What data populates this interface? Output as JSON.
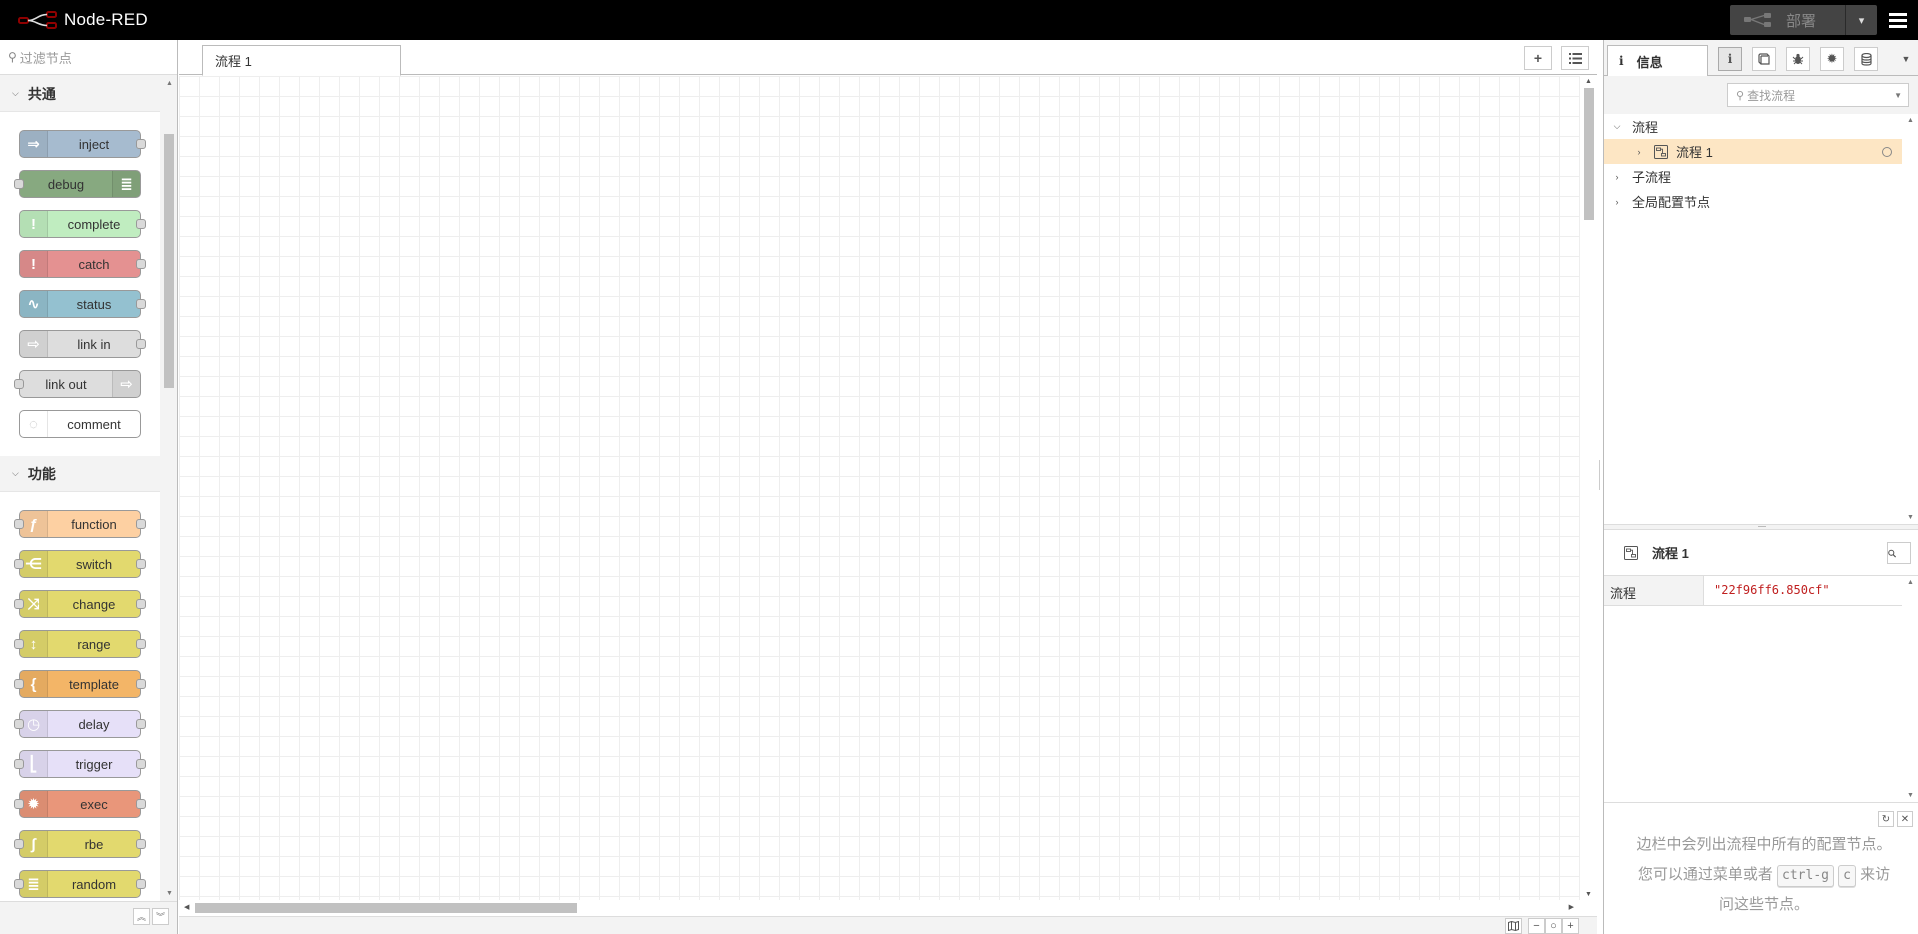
{
  "header": {
    "app_title": "Node-RED",
    "deploy_label": "部署",
    "deploy_caret": "▾",
    "menu_icon": "hamburger-icon"
  },
  "palette": {
    "search_placeholder": "过滤节点",
    "categories": [
      {
        "label": "共通",
        "nodes": [
          {
            "label": "inject",
            "color": "#a6bbcf",
            "icon_side": "left",
            "icon": "arrow-right-icon",
            "glyph": "⇒",
            "in": false,
            "out": true
          },
          {
            "label": "debug",
            "color": "#87a980",
            "icon_side": "right",
            "icon": "list-icon",
            "glyph": "≣",
            "in": true,
            "out": false
          },
          {
            "label": "complete",
            "color": "#c0edc0",
            "icon_side": "left",
            "icon": "exclamation-icon",
            "glyph": "!",
            "in": false,
            "out": true
          },
          {
            "label": "catch",
            "color": "#e49191",
            "icon_side": "left",
            "icon": "exclamation-icon",
            "glyph": "!",
            "in": false,
            "out": true
          },
          {
            "label": "status",
            "color": "#94c1d0",
            "icon_side": "left",
            "icon": "pulse-icon",
            "glyph": "∿",
            "in": false,
            "out": true
          },
          {
            "label": "link in",
            "color": "#dddddd",
            "icon_side": "left",
            "icon": "link-in-icon",
            "glyph": "⇨",
            "in": false,
            "out": true
          },
          {
            "label": "link out",
            "color": "#dddddd",
            "icon_side": "right",
            "icon": "link-out-icon",
            "glyph": "⇨",
            "in": true,
            "out": false
          },
          {
            "label": "comment",
            "color": "#ffffff",
            "icon_side": "left",
            "icon": "speech-bubble-icon",
            "glyph": "◌",
            "in": false,
            "out": false
          }
        ]
      },
      {
        "label": "功能",
        "nodes": [
          {
            "label": "function",
            "color": "#fdd0a2",
            "icon_side": "left",
            "icon": "function-icon",
            "glyph": "ƒ",
            "in": true,
            "out": true
          },
          {
            "label": "switch",
            "color": "#e2d96e",
            "icon_side": "left",
            "icon": "switch-icon",
            "glyph": "⋲",
            "in": true,
            "out": true
          },
          {
            "label": "change",
            "color": "#e2d96e",
            "icon_side": "left",
            "icon": "shuffle-icon",
            "glyph": "⤨",
            "in": true,
            "out": true
          },
          {
            "label": "range",
            "color": "#e2d96e",
            "icon_side": "left",
            "icon": "range-icon",
            "glyph": "↕",
            "in": true,
            "out": true
          },
          {
            "label": "template",
            "color": "#f3b567",
            "icon_side": "left",
            "icon": "brace-icon",
            "glyph": "{",
            "in": true,
            "out": true
          },
          {
            "label": "delay",
            "color": "#e6e0f8",
            "icon_side": "left",
            "icon": "timer-icon",
            "glyph": "◷",
            "in": true,
            "out": true
          },
          {
            "label": "trigger",
            "color": "#e6e0f8",
            "icon_side": "left",
            "icon": "trigger-icon",
            "glyph": "⎣",
            "in": true,
            "out": true
          },
          {
            "label": "exec",
            "color": "#e9967a",
            "icon_side": "left",
            "icon": "gear-icon",
            "glyph": "✹",
            "in": true,
            "out": true
          },
          {
            "label": "rbe",
            "color": "#e2d96e",
            "icon_side": "left",
            "icon": "rbe-icon",
            "glyph": "∫",
            "in": true,
            "out": true
          },
          {
            "label": "random",
            "color": "#e2d96e",
            "icon_side": "left",
            "icon": "dice-icon",
            "glyph": "≣",
            "in": true,
            "out": true
          }
        ]
      }
    ]
  },
  "workspace": {
    "tabs": [
      {
        "label": "流程 1"
      }
    ],
    "add_tab_icon": "plus-icon",
    "list_tabs_icon": "list-icon",
    "footer_buttons": [
      "map-icon",
      "zoom-out-icon",
      "zoom-reset-icon",
      "zoom-in-icon"
    ]
  },
  "sidebar": {
    "active_tab_label": "信息",
    "tab_buttons": [
      "info-icon",
      "book-icon",
      "bug-icon",
      "gear-icon",
      "database-icon"
    ],
    "search_placeholder": "查找流程",
    "tree": {
      "flows_label": "流程",
      "flow_items": [
        {
          "label": "流程 1"
        }
      ],
      "subflows_label": "子流程",
      "global_config_label": "全局配置节点"
    },
    "properties": {
      "title": "流程 1",
      "rows": [
        {
          "key": "流程",
          "value": "\"22f96ff6.850cf\""
        }
      ]
    },
    "help": {
      "line1": "边栏中会列出流程中所有的配置节点。",
      "line2_prefix": "您可以通过菜单或者",
      "kbd1": "ctrl-g",
      "kbd2": "c",
      "line2_suffix": "来访",
      "line3": "问这些节点。"
    }
  }
}
